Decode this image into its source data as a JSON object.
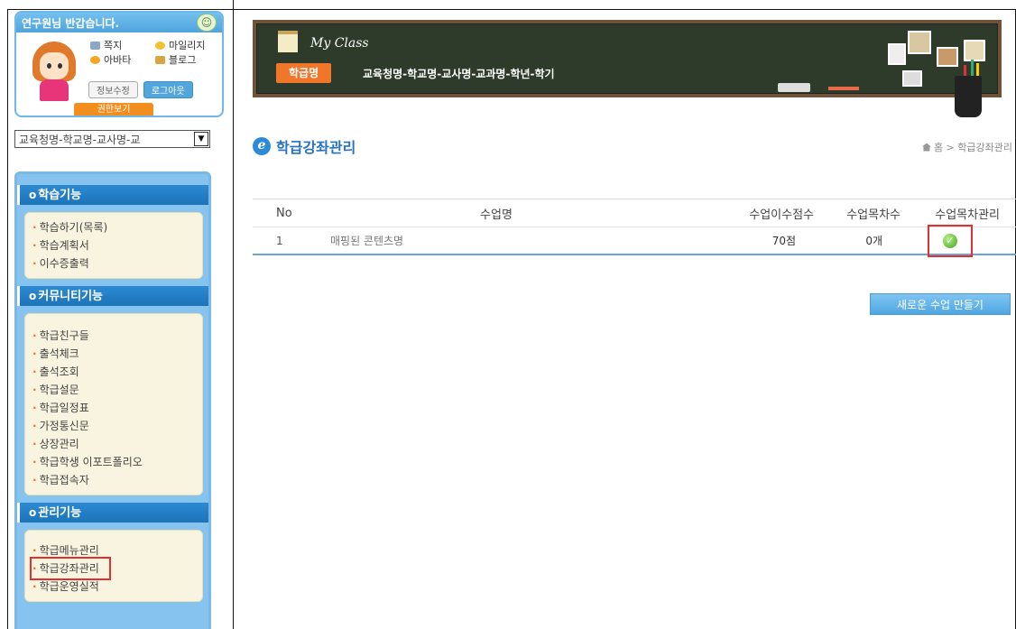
{
  "profile": {
    "greeting": "연구원님 반갑습니다.",
    "links": [
      "쪽지",
      "마일리지",
      "아바타",
      "블로그"
    ],
    "edit_label": "정보수정",
    "logout_label": "로그아웃",
    "auth_label": "권한보기"
  },
  "class_select": {
    "value": "교육청명-학교명-교사명-교"
  },
  "menu": {
    "sections": [
      {
        "title": "학습기능",
        "items": [
          "학습하기(목록)",
          "학습계획서",
          "이수증출력"
        ]
      },
      {
        "title": "커뮤니티기능",
        "items": [
          "학급친구들",
          "출석체크",
          "출석조회",
          "학급설문",
          "학급일정표",
          "가정통신문",
          "상장관리",
          "학급학생 이포트폴리오",
          "학급접속자"
        ]
      },
      {
        "title": "관리기능",
        "items": [
          "학급메뉴관리",
          "학급강좌관리",
          "학급운영실적"
        ]
      }
    ]
  },
  "banner": {
    "title": "My Class",
    "badge": "학급명",
    "path": "교육청명-학교명-교사명-교과명-학년-학기"
  },
  "page": {
    "title": "학급강좌관리",
    "breadcrumb": "홈 > 학급강좌관리"
  },
  "table": {
    "headers": [
      "No",
      "수업명",
      "수업이수점수",
      "수업목차수",
      "수업목차관리"
    ],
    "rows": [
      {
        "no": "1",
        "name": "매핑된 콘텐츠명",
        "score": "70점",
        "count": "0개"
      }
    ]
  },
  "new_button": "새로운 수업 만들기",
  "colors": {
    "accent_blue": "#2772c2",
    "menu_blue": "#1d73b9",
    "badge_orange": "#f0772a",
    "highlight_red": "#e23030"
  }
}
